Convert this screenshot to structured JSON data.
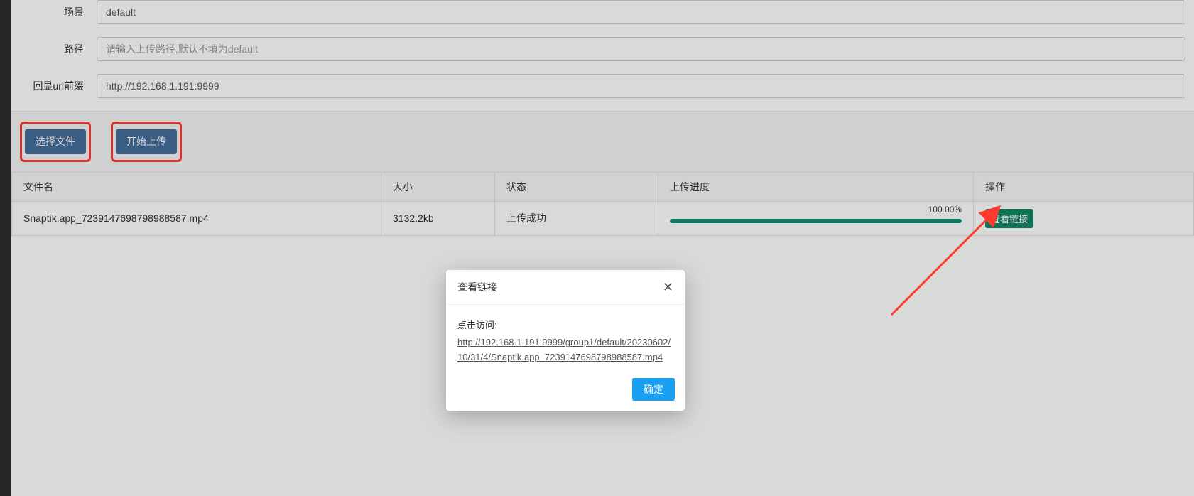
{
  "form": {
    "scene": {
      "label": "场景",
      "value": "default"
    },
    "path": {
      "label": "路径",
      "placeholder": "请输入上传路径,默认不填为default",
      "value": ""
    },
    "url_prefix": {
      "label": "回显url前缀",
      "value": "http://192.168.1.191:9999"
    }
  },
  "buttons": {
    "choose_file": "选择文件",
    "start_upload": "开始上传"
  },
  "table": {
    "headers": {
      "filename": "文件名",
      "size": "大小",
      "status": "状态",
      "progress": "上传进度",
      "action": "操作"
    },
    "rows": [
      {
        "filename": "Snaptik.app_7239147698798988587.mp4",
        "size": "3132.2kb",
        "status": "上传成功",
        "progress_pct": "100.00%",
        "action_label": "查看链接"
      }
    ]
  },
  "modal": {
    "title": "查看链接",
    "prompt": "点击访问:",
    "url": "http://192.168.1.191:9999/group1/default/20230602/10/31/4/Snaptik.app_7239147698798988587.mp4",
    "confirm": "确定"
  }
}
